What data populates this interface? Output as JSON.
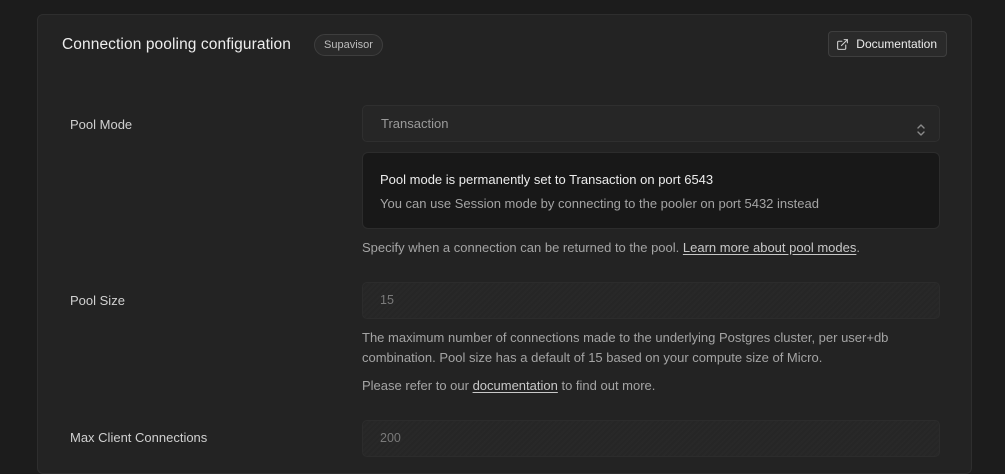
{
  "header": {
    "title": "Connection pooling configuration",
    "badge": "Supavisor",
    "doc_button_label": "Documentation",
    "doc_icon": "external-link-icon"
  },
  "pool_mode": {
    "label": "Pool Mode",
    "value": "Transaction",
    "alert_title": "Pool mode is permanently set to Transaction on port 6543",
    "alert_description": "You can use Session mode by connecting to the pooler on port 5432 instead",
    "help_text": "Specify when a connection can be returned to the pool. ",
    "help_link": "Learn more about pool modes",
    "help_suffix": "."
  },
  "pool_size": {
    "label": "Pool Size",
    "value": "15",
    "help_text": "The maximum number of connections made to the underlying Postgres cluster, per user+db combination. Pool size has a default of 15 based on your compute size of Micro.",
    "refer_prefix": "Please refer to our ",
    "refer_link": "documentation",
    "refer_suffix": " to find out more."
  },
  "max_client": {
    "label": "Max Client Connections",
    "value": "200"
  },
  "colors": {
    "background": "#1c1c1c",
    "card": "#232323",
    "alert": "#181818"
  }
}
